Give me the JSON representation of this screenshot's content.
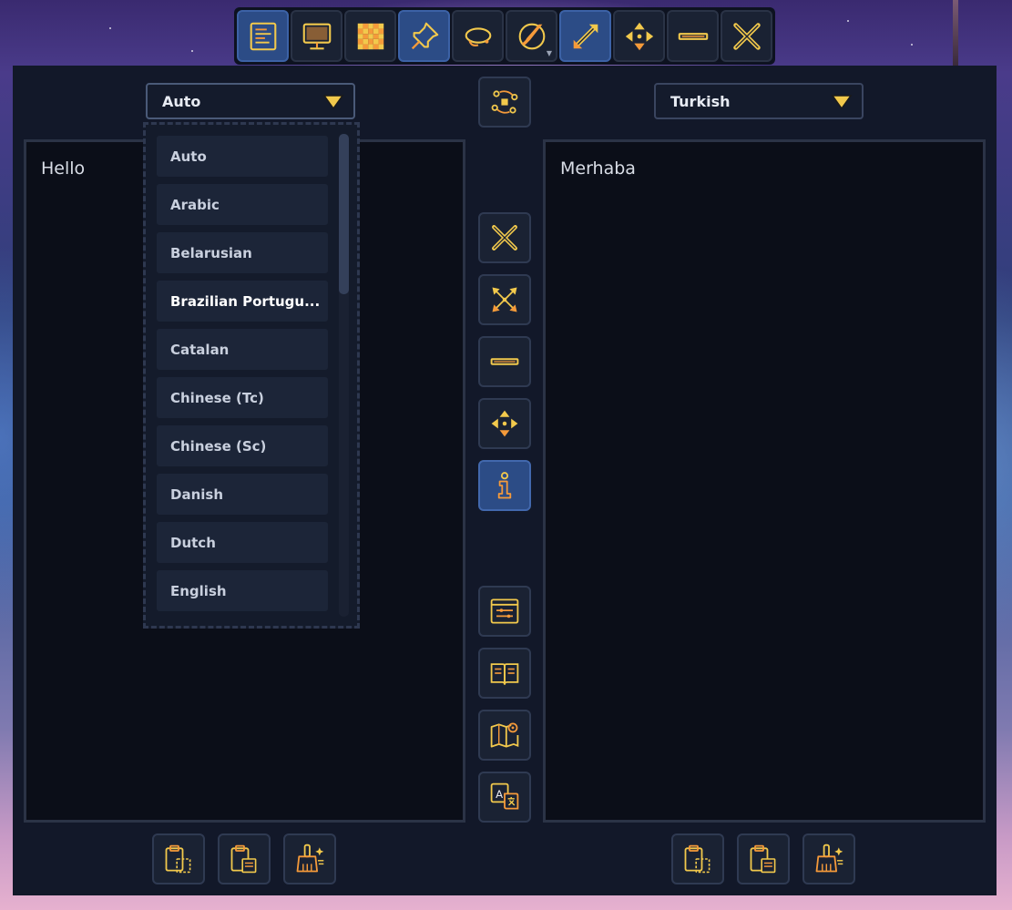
{
  "toolbar": {
    "buttons": [
      {
        "name": "text-mode-icon",
        "active": true
      },
      {
        "name": "monitor-icon",
        "active": false
      },
      {
        "name": "checkerboard-icon",
        "active": false
      },
      {
        "name": "pin-icon",
        "active": true
      },
      {
        "name": "lasso-icon",
        "active": false
      },
      {
        "name": "paint-brush-icon",
        "active": false
      },
      {
        "name": "resize-diagonal-icon",
        "active": true
      },
      {
        "name": "move-icon",
        "active": false
      },
      {
        "name": "minimize-icon",
        "active": false
      },
      {
        "name": "close-icon",
        "active": false
      }
    ]
  },
  "source": {
    "language": "Auto",
    "text": "Hello"
  },
  "target": {
    "language": "Turkish",
    "text": "Merhaba"
  },
  "dropdown": {
    "options": [
      "Auto",
      "Arabic",
      "Belarusian",
      "Brazilian Portugu...",
      "Catalan",
      "Chinese (Tc)",
      "Chinese (Sc)",
      "Danish",
      "Dutch",
      "English"
    ],
    "hovered_index": 3
  },
  "side_buttons": [
    "swap-languages-icon",
    "close-icon",
    "expand-icon",
    "minimize-icon",
    "move-icon",
    "info-icon",
    "settings-window-icon",
    "dictionary-icon",
    "map-icon",
    "translate-icon"
  ],
  "bottom_buttons": [
    "paste-icon",
    "copy-icon",
    "clear-icon"
  ],
  "colors": {
    "accent_gold": "#f2c94c",
    "accent_orange": "#f59a3a",
    "panel_bg": "#121829",
    "active_button": "#2c4c86"
  }
}
